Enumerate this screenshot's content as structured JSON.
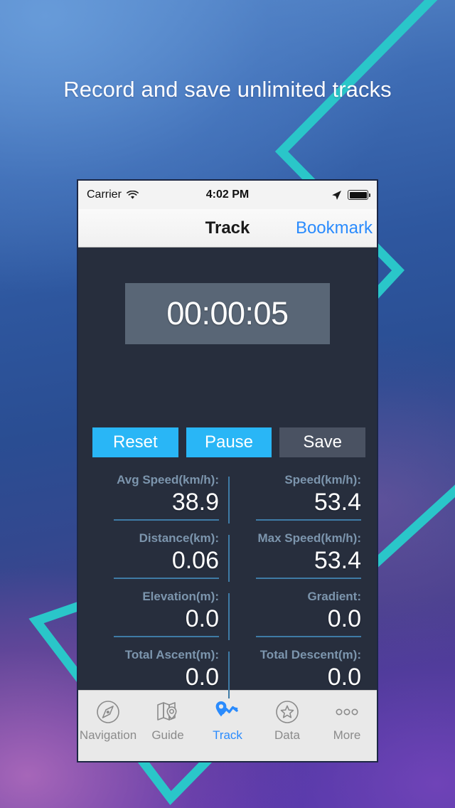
{
  "promo": {
    "headline": "Record and save unlimited tracks",
    "accent_color": "#2ac6c9"
  },
  "phone": {
    "status_bar": {
      "carrier": "Carrier",
      "wifi_icon": "wifi-icon",
      "time": "4:02 PM",
      "location_icon": "location-arrow-icon",
      "battery_icon": "battery-full-icon"
    },
    "nav_bar": {
      "title": "Track",
      "right_action": "Bookmark"
    },
    "timer": {
      "value": "00:00:05"
    },
    "buttons": [
      {
        "label": "Reset",
        "style": "primary",
        "color": "#29b6f6"
      },
      {
        "label": "Pause",
        "style": "primary",
        "color": "#29b6f6"
      },
      {
        "label": "Save",
        "style": "muted",
        "color": "#4a5262"
      }
    ],
    "stats": [
      {
        "left": {
          "label": "Avg Speed(km/h):",
          "value": "38.9",
          "underline": true
        },
        "right": {
          "label": "Speed(km/h):",
          "value": "53.4",
          "underline": true
        }
      },
      {
        "left": {
          "label": "Distance(km):",
          "value": "0.06",
          "underline": true
        },
        "right": {
          "label": "Max Speed(km/h):",
          "value": "53.4",
          "underline": true
        }
      },
      {
        "left": {
          "label": "Elevation(m):",
          "value": "0.0",
          "underline": true
        },
        "right": {
          "label": "Gradient:",
          "value": "0.0",
          "underline": true
        }
      },
      {
        "left": {
          "label": "Total Ascent(m):",
          "value": "0.0",
          "underline": false
        },
        "right": {
          "label": "Total Descent(m):",
          "value": "0.0",
          "underline": false
        }
      }
    ],
    "tabs": [
      {
        "label": "Navigation",
        "icon": "compass-icon",
        "active": false
      },
      {
        "label": "Guide",
        "icon": "map-icon",
        "active": false
      },
      {
        "label": "Track",
        "icon": "route-pin-icon",
        "active": true
      },
      {
        "label": "Data",
        "icon": "star-circle-icon",
        "active": false
      },
      {
        "label": "More",
        "icon": "ellipsis-icon",
        "active": false
      }
    ],
    "active_color": "#2a8bfd",
    "inactive_color": "#8b8b8b"
  }
}
